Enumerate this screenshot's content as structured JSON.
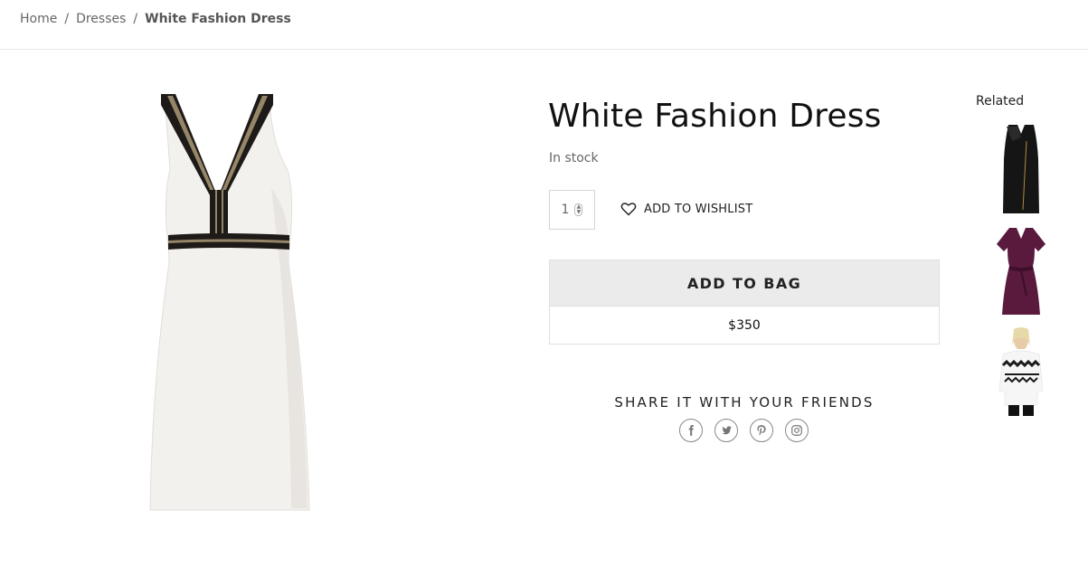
{
  "breadcrumb": {
    "home": "Home",
    "separator": "/",
    "category": "Dresses",
    "current": "White Fashion Dress"
  },
  "product": {
    "title": "White Fashion Dress",
    "stock_status": "In stock",
    "quantity": "1",
    "wishlist_label": "ADD TO WISHLIST",
    "add_to_bag_label": "ADD TO BAG",
    "price": "$350"
  },
  "share": {
    "title": "SHARE IT WITH YOUR FRIENDS",
    "icons": [
      "facebook-icon",
      "twitter-icon",
      "pinterest-icon",
      "instagram-icon"
    ]
  },
  "related": {
    "title": "Related",
    "items": [
      "black-zip-dress-thumbnail",
      "purple-wrap-dress-thumbnail",
      "patterned-sweater-thumbnail"
    ]
  },
  "colors": {
    "button_bg": "#ebebeb",
    "text": "#222222",
    "muted": "#666666"
  }
}
